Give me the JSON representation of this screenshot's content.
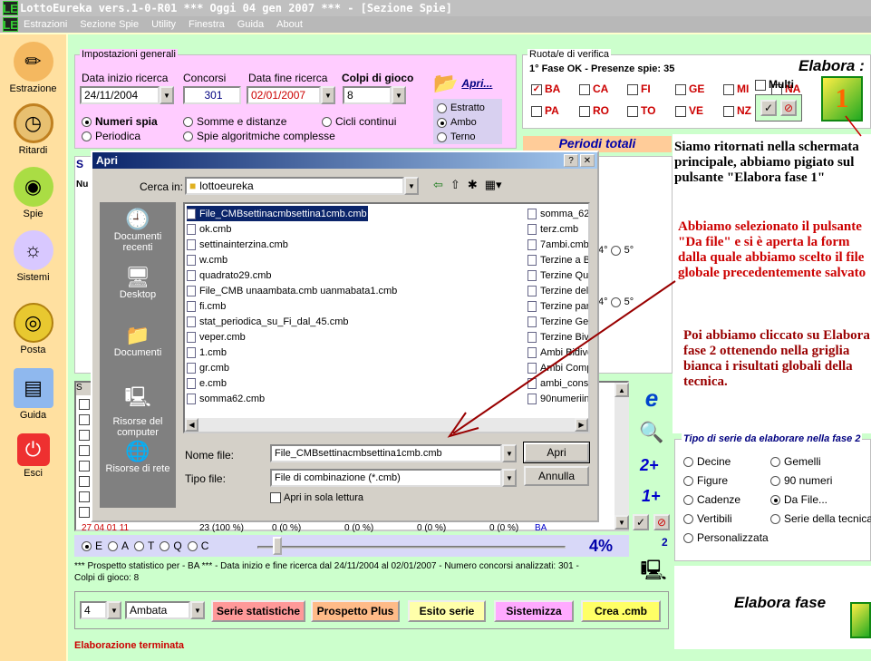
{
  "app": {
    "title": "LottoEureka vers.1-0-R01  ***  Oggi 04 gen 2007  ***   - [Sezione Spie]",
    "logo": "LE"
  },
  "menu": [
    "Estrazioni",
    "Sezione Spie",
    "Utility",
    "Finestra",
    "Guida",
    "About"
  ],
  "sidebar": [
    {
      "label": "Estrazione",
      "icon": "pencil-icon"
    },
    {
      "label": "Ritardi",
      "icon": "clock-icon"
    },
    {
      "label": "Spie",
      "icon": "flashlight-icon"
    },
    {
      "label": "Sistemi",
      "icon": "lightbulb-icon"
    },
    {
      "label": "Posta",
      "icon": "coin-icon"
    },
    {
      "label": "Guida",
      "icon": "book-icon"
    },
    {
      "label": "Esci",
      "icon": "power-icon"
    }
  ],
  "settings": {
    "legend": "Impostazioni generali",
    "start_label": "Data inizio ricerca",
    "start_value": "24/11/2004",
    "contests_label": "Concorsi",
    "contests_value": "301",
    "end_label": "Data fine ricerca",
    "end_value": "02/01/2007",
    "shots_label": "Colpi di gioco",
    "shots_value": "8",
    "open_label": "Apri...",
    "modes": [
      {
        "label": "Numeri spia",
        "on": true
      },
      {
        "label": "Somme e distanze",
        "on": false
      },
      {
        "label": "Cicli continui",
        "on": false
      },
      {
        "label": "Periodica",
        "on": false
      },
      {
        "label": "Spie algoritmiche complesse",
        "on": false
      }
    ],
    "target": [
      {
        "label": "Estratto",
        "on": false
      },
      {
        "label": "Ambo",
        "on": true
      },
      {
        "label": "Terno",
        "on": false
      }
    ]
  },
  "wheels": {
    "legend": "Ruota/e di verifica",
    "status": "1° Fase OK - Presenze spie: 35",
    "items": [
      {
        "label": "BA",
        "on": true
      },
      {
        "label": "CA",
        "on": false
      },
      {
        "label": "FI",
        "on": false
      },
      {
        "label": "GE",
        "on": false
      },
      {
        "label": "MI",
        "on": false
      },
      {
        "label": "NA",
        "on": false
      },
      {
        "label": "PA",
        "on": false
      },
      {
        "label": "RO",
        "on": false
      },
      {
        "label": "TO",
        "on": false
      },
      {
        "label": "VE",
        "on": false
      },
      {
        "label": "NZ",
        "on": false
      }
    ],
    "multi": "Multi",
    "elabora1": "Elabora :",
    "phase1": "1"
  },
  "periodi": "Periodi totali",
  "dialog": {
    "title": "Apri",
    "lookin_label": "Cerca in:",
    "lookin_value": "lottoeureka",
    "places": [
      "Documenti recenti",
      "Desktop",
      "Documenti",
      "Risorse del computer",
      "Risorse di rete"
    ],
    "files_left": [
      "File_CMBsettinacmbsettina1cmb.cmb",
      "ok.cmb",
      "settinainterzina.cmb",
      "w.cmb",
      "quadrato29.cmb",
      "File_CMB unaambata.cmb uanmabata1.cmb",
      "fi.cmb",
      "stat_periodica_su_Fi_dal_45.cmb",
      "veper.cmb",
      "1.cmb",
      "gr.cmb",
      "e.cmb",
      "somma62.cmb"
    ],
    "files_right": [
      "somma_62",
      "terz.cmb",
      "7ambi.cmb",
      "Terzine a B",
      "Terzine Qu",
      "Terzine del",
      "Terzine par",
      "Terzine Ger",
      "Terzine Biv",
      "Ambi Bidive",
      "Ambi Comp",
      "ambi_conse",
      "90numeriin"
    ],
    "filename_label": "Nome file:",
    "filename_value": "File_CMBsettinacmbsettina1cmb.cmb",
    "filetype_label": "Tipo file:",
    "filetype_value": "File di combinazione (*.cmb)",
    "open_btn": "Apri",
    "cancel_btn": "Annulla",
    "readonly_label": "Apri in sola lettura"
  },
  "mid": {
    "opt4": "4°",
    "opt5": "5°",
    "row_label": "27 04 01 11",
    "row_vals": [
      "23 (100 %)",
      "0 (0 %)",
      "0 (0 %)",
      "0 (0 %)",
      "0 (0 %)",
      "BA"
    ],
    "col_head": "S"
  },
  "slider": {
    "options": [
      "E",
      "A",
      "T",
      "Q",
      "C"
    ],
    "percent": "4%",
    "value_fraction": 0.04
  },
  "info": {
    "line1": "*** Prospetto statistico per  - BA *** - Data inizio e fine ricerca dal 24/11/2004 al 02/01/2007 - Numero concorsi analizzati: 301 -",
    "line2": "Colpi di gioco: 8"
  },
  "bottom": {
    "num": "4",
    "type": "Ambata",
    "b1": "Serie statistiche",
    "b2": "Prospetto Plus",
    "b3": "Esito serie",
    "b4": "Sistemizza",
    "b5": "Crea .cmb",
    "status": "Elaborazione terminata",
    "two": "2"
  },
  "series": {
    "legend": "Tipo di serie da elaborare nella fase 2",
    "items": [
      {
        "label": "Decine",
        "on": false
      },
      {
        "label": "Gemelli",
        "on": false
      },
      {
        "label": "Figure",
        "on": false
      },
      {
        "label": "90 numeri",
        "on": false
      },
      {
        "label": "Cadenze",
        "on": false
      },
      {
        "label": "Da File...",
        "on": true
      },
      {
        "label": "Vertibili",
        "on": false
      },
      {
        "label": "Serie della tecnica",
        "on": false
      },
      {
        "label": "Personalizzata",
        "on": false
      }
    ],
    "elabora2": "Elabora fase"
  },
  "tools": {
    "p2": "2+",
    "p1": "1+"
  },
  "annotations": {
    "a1": "Siamo ritornati nella schermata principale, abbiamo pigiato sul pulsante \"Elabora fase 1\"",
    "a2": "Abbiamo selezionato il pulsante \"Da file\" e si è aperta la form dalla quale abbiamo scelto il file globale precedentemente salvato",
    "a3": "Poi abbiamo cliccato su Elabora fase 2 ottenendo nella griglia bianca i risultati globali della tecnica."
  },
  "colors": {
    "pink": "#ffccff",
    "green": "#ccffcc",
    "red_annot": "#cc0000"
  }
}
